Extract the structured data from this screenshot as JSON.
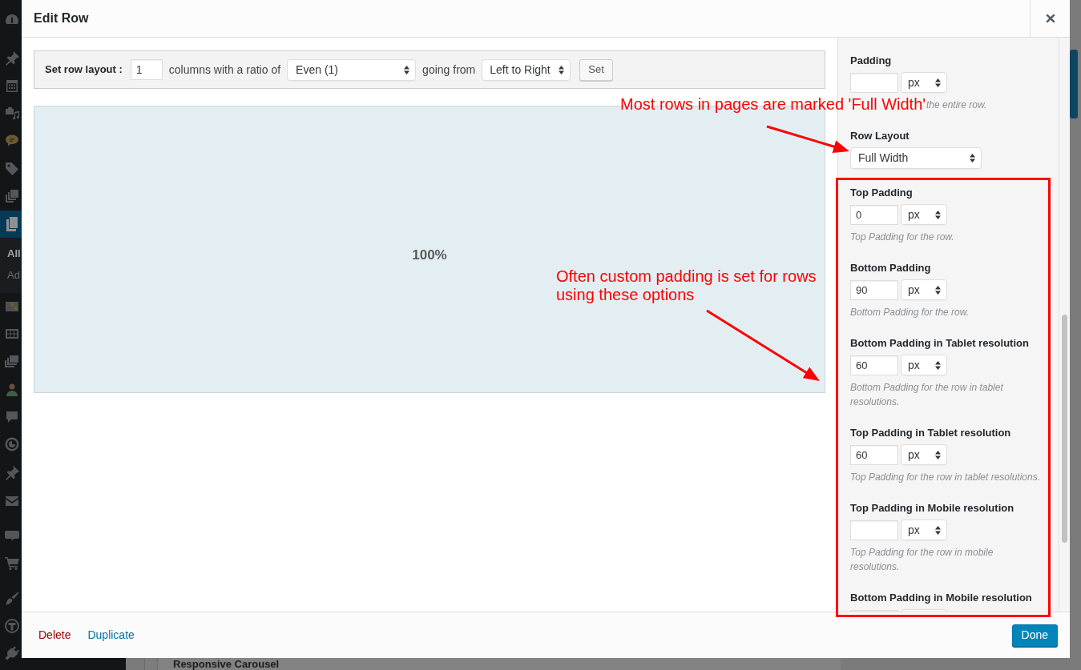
{
  "admin_menu": {
    "items": [
      {
        "selected": false
      },
      {
        "selected": false
      },
      {
        "selected": false
      },
      {
        "selected": false
      },
      {
        "selected": false
      },
      {
        "selected": false
      },
      {
        "selected": false
      },
      {
        "selected": true
      },
      {
        "selected": false
      },
      {
        "selected": false
      },
      {
        "selected": false
      },
      {
        "selected": false
      },
      {
        "selected": false
      },
      {
        "selected": false
      },
      {
        "selected": false
      },
      {
        "selected": false
      },
      {
        "selected": false
      },
      {
        "selected": false
      },
      {
        "selected": false
      },
      {
        "selected": false
      },
      {
        "selected": false
      }
    ],
    "submenu": [
      {
        "label": "All",
        "selected": true
      },
      {
        "label": "Ad",
        "selected": false
      }
    ]
  },
  "background_panel": {
    "title": "Responsive Carousel"
  },
  "modal": {
    "title": "Edit Row",
    "layout_bar": {
      "label": "Set row layout :",
      "columns_value": "1",
      "columns_text": "columns with a ratio of",
      "ratio": "Even (1)",
      "direction_text": "going from",
      "direction": "Left to Right",
      "button": "Set"
    },
    "columns": [
      {
        "label": "100%"
      }
    ],
    "settings": [
      {
        "kind": "size",
        "label": "Padding",
        "unit": "px",
        "description": "the entire row.",
        "covered": true
      },
      {
        "kind": "select",
        "label": "Row Layout",
        "value": "Full Width"
      },
      {
        "kind": "size",
        "label": "Top Padding",
        "value": "0",
        "unit": "px",
        "description": "Top Padding for the row."
      },
      {
        "kind": "size",
        "label": "Bottom Padding",
        "value": "90",
        "unit": "px",
        "description": "Bottom Padding for the row."
      },
      {
        "kind": "size",
        "label": "Bottom Padding in Tablet resolution",
        "value": "60",
        "unit": "px",
        "description": "Bottom Padding for the row in tablet resolutions."
      },
      {
        "kind": "size",
        "label": "Top Padding in Tablet resolution",
        "value": "60",
        "unit": "px",
        "description": "Top Padding for the row in tablet resolutions."
      },
      {
        "kind": "size",
        "label": "Top Padding in Mobile resolution",
        "unit": "px",
        "description": "Top Padding for the row in mobile resolutions."
      },
      {
        "kind": "size",
        "label": "Bottom Padding in Mobile resolution"
      }
    ],
    "footer": {
      "links": [
        {
          "label": "Delete",
          "kind": "danger"
        },
        {
          "label": "Duplicate",
          "kind": "default"
        }
      ],
      "button": "Done"
    }
  },
  "annotations": [
    {
      "text": "Most rows in pages are marked 'Full Width'"
    },
    {
      "text": "Often custom padding is set for rows using these options"
    }
  ]
}
